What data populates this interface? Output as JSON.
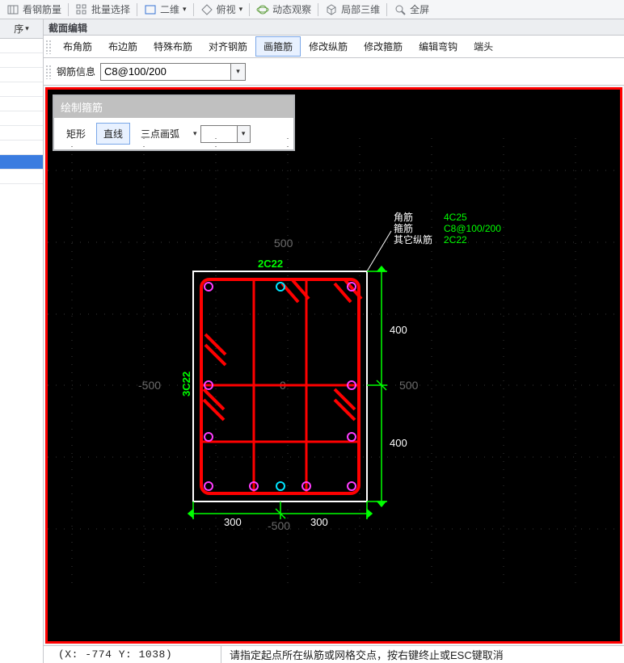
{
  "app_toolbar": {
    "items": [
      {
        "id": "rebar-qty",
        "label": "看钢筋量"
      },
      {
        "id": "batch-sel",
        "label": "批量选择"
      },
      {
        "id": "view2d",
        "label": "二维"
      },
      {
        "id": "view-top",
        "label": "俯视"
      },
      {
        "id": "dyn-view",
        "label": "动态观察"
      },
      {
        "id": "local-3d",
        "label": "局部三维"
      },
      {
        "id": "fullscreen",
        "label": "全屏"
      }
    ]
  },
  "left_panel": {
    "header": "序",
    "row_count": 10,
    "selected_index": 8
  },
  "editor": {
    "title": "截面编辑",
    "menu": [
      {
        "id": "corner",
        "label": "布角筋"
      },
      {
        "id": "edge",
        "label": "布边筋"
      },
      {
        "id": "special",
        "label": "特殊布筋"
      },
      {
        "id": "align",
        "label": "对齐钢筋"
      },
      {
        "id": "stirrup",
        "label": "画箍筋",
        "active": true
      },
      {
        "id": "modv",
        "label": "修改纵筋"
      },
      {
        "id": "mods",
        "label": "修改箍筋"
      },
      {
        "id": "hook",
        "label": "编辑弯钩"
      },
      {
        "id": "end",
        "label": "端头"
      }
    ],
    "info_label": "钢筋信息",
    "info_value": "C8@100/200",
    "float": {
      "title": "绘制箍筋",
      "options": [
        "矩形",
        "直线",
        "三点画弧"
      ],
      "active": 1
    },
    "drawing": {
      "axes": {
        "top": "500",
        "bottom": "-500",
        "left": "-500",
        "right": "500"
      },
      "top_label": "2C22",
      "left_label": "3C22",
      "dims_right": [
        "400",
        "400"
      ],
      "dims_bottom": [
        "300",
        "300"
      ],
      "legend": {
        "rows": [
          {
            "k": "角筋",
            "v": "4C25"
          },
          {
            "k": "箍筋",
            "v": "C8@100/200"
          },
          {
            "k": "其它纵筋",
            "v": "2C22"
          }
        ]
      }
    }
  },
  "status": {
    "coord": "(X: -774 Y: 1038)",
    "prompt": "请指定起点所在纵筋或网格交点，按右键终止或ESC键取消"
  },
  "colors": {
    "accent_red": "#ff0000",
    "accent_green": "#00ff00",
    "grid": "#3a3a3a",
    "dim": "#888888"
  },
  "chart_data": {
    "type": "table",
    "description": "Reinforced concrete column cross-section stirrup layout",
    "section": {
      "width_mm": 600,
      "width_segments": [
        300,
        300
      ],
      "height_mm": 800,
      "height_segments": [
        400,
        400
      ]
    },
    "rebar": {
      "corner": "4C25",
      "other_longitudinal": "2C22",
      "stirrup": "C8@100/200"
    },
    "labels": {
      "top": "2C22",
      "left": "3C22"
    }
  }
}
